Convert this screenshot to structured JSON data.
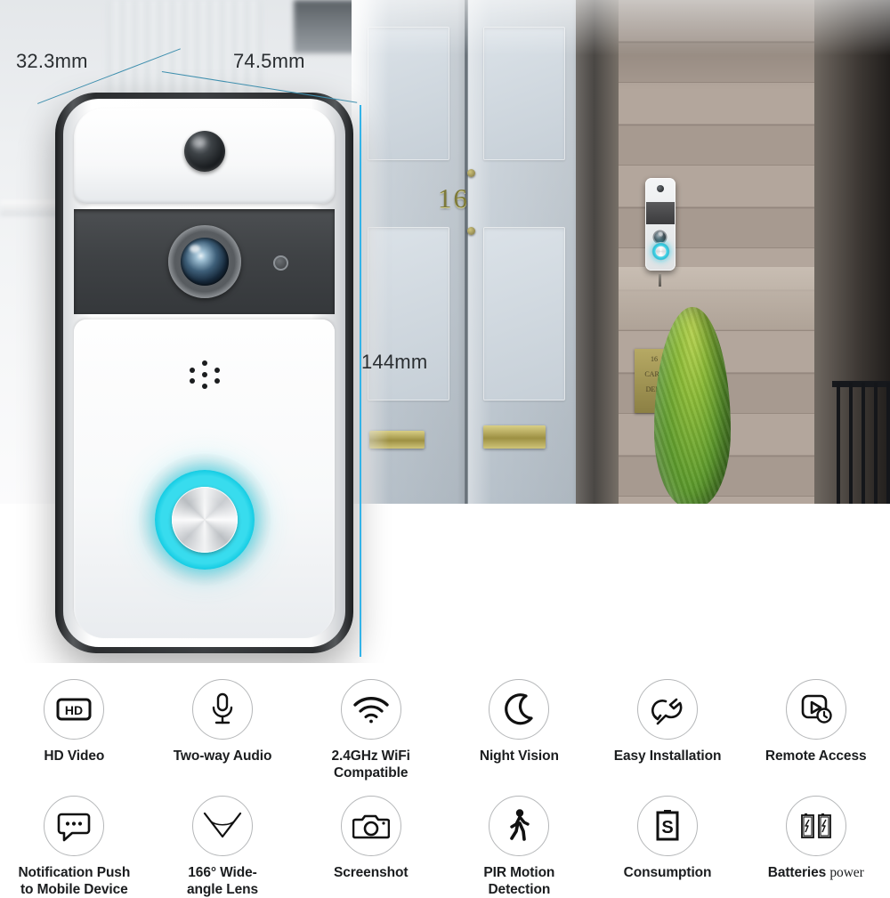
{
  "product": {
    "name": "wifi-video-doorbell",
    "button_glow_color": "#38dcee",
    "dimension_line_color": "#33b3e8"
  },
  "dimensions": {
    "depth": "32.3mm",
    "width": "74.5mm",
    "height": "144mm"
  },
  "scene": {
    "house_number": "16",
    "plaque_line1": "16",
    "plaque_line2": "CARL",
    "plaque_line3": "DERI"
  },
  "features": {
    "row1": [
      {
        "label": "HD Video",
        "icon": "hd-video-icon",
        "badge": "HD"
      },
      {
        "label": "Two-way Audio",
        "icon": "microphone-icon"
      },
      {
        "label": "2.4GHz WiFi\nCompatible",
        "line1": "2.4GHz WiFi",
        "line2": "Compatible",
        "icon": "wifi-icon"
      },
      {
        "label": "Night Vision",
        "icon": "moon-icon"
      },
      {
        "label": "Easy Installation",
        "icon": "wrench-icon"
      },
      {
        "label": "Remote Access",
        "icon": "remote-play-clock-icon"
      }
    ],
    "row2": [
      {
        "label": "Notification Push\nto Mobile Device",
        "line1": "Notification Push",
        "line2": "to Mobile Device",
        "icon": "chat-bubble-icon"
      },
      {
        "label": "166° Wide-\nangle Lens",
        "line1": "166° Wide-",
        "line2": "angle Lens",
        "icon": "wide-angle-icon"
      },
      {
        "label": "Screenshot",
        "icon": "camera-icon"
      },
      {
        "label": "PIR Motion\nDetection",
        "line1": "PIR Motion",
        "line2": "Detection",
        "icon": "walking-person-icon"
      },
      {
        "label": "Consumption",
        "icon": "battery-s-icon"
      },
      {
        "label": "Batteries power",
        "line1": "Batteries",
        "line2": "power",
        "icon": "two-batteries-icon"
      }
    ]
  }
}
